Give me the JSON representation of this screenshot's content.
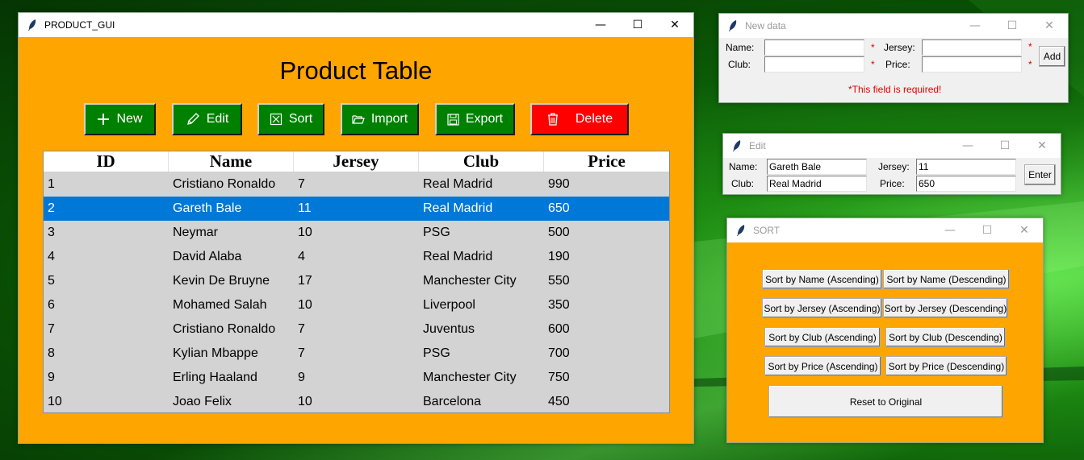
{
  "main_window": {
    "title": "PRODUCT_GUI",
    "heading": "Product Table",
    "buttons": {
      "new": "New",
      "edit": "Edit",
      "sort": "Sort",
      "import": "Import",
      "export": "Export",
      "delete": "Delete"
    },
    "columns": [
      "ID",
      "Name",
      "Jersey",
      "Club",
      "Price"
    ],
    "rows": [
      [
        "1",
        "Cristiano Ronaldo",
        "7",
        "Real Madrid",
        "990"
      ],
      [
        "2",
        "Gareth Bale",
        "11",
        "Real Madrid",
        "650"
      ],
      [
        "3",
        "Neymar",
        "10",
        "PSG",
        "500"
      ],
      [
        "4",
        "David Alaba",
        "4",
        "Real Madrid",
        "190"
      ],
      [
        "5",
        "Kevin De Bruyne",
        "17",
        "Manchester City",
        "550"
      ],
      [
        "6",
        "Mohamed Salah",
        "10",
        "Liverpool",
        "350"
      ],
      [
        "7",
        "Cristiano Ronaldo",
        "7",
        "Juventus",
        "600"
      ],
      [
        "8",
        "Kylian Mbappe",
        "7",
        "PSG",
        "700"
      ],
      [
        "9",
        "Erling Haaland",
        "9",
        "Manchester City",
        "750"
      ],
      [
        "10",
        "Joao Felix",
        "10",
        "Barcelona",
        "450"
      ]
    ],
    "selected_row": 1
  },
  "new_data_window": {
    "title": "New data",
    "name_label": "Name:",
    "jersey_label": "Jersey:",
    "club_label": "Club:",
    "price_label": "Price:",
    "required_mark": "*",
    "add_button": "Add",
    "error_text": "*This field is required!"
  },
  "edit_window": {
    "title": "Edit",
    "name_label": "Name:",
    "name_value": "Gareth Bale",
    "jersey_label": "Jersey:",
    "jersey_value": "11",
    "club_label": "Club:",
    "club_value": "Real Madrid",
    "price_label": "Price:",
    "price_value": "650",
    "enter_button": "Enter"
  },
  "sort_window": {
    "title": "SORT",
    "buttons": [
      "Sort by Name (Ascending)",
      "Sort by Name (Descending)",
      "Sort by Jersey (Ascending)",
      "Sort by Jersey (Descending)",
      "Sort by Club (Ascending)",
      "Sort by Club (Descending)",
      "Sort by Price (Ascending)",
      "Sort by Price (Descending)"
    ],
    "reset_button": "Reset to Original"
  },
  "colors": {
    "app_background": "#ffa500",
    "button_green": "#008000",
    "button_red": "#ff0000",
    "selection_blue": "#0078d7",
    "table_background": "#d3d3d3",
    "required_red": "#e00000"
  },
  "icons": {
    "new": "plus-icon",
    "edit": "pencil-icon",
    "sort": "sort-icon",
    "import": "folder-icon",
    "export": "save-icon",
    "delete": "trash-icon",
    "window": "feather-icon"
  }
}
